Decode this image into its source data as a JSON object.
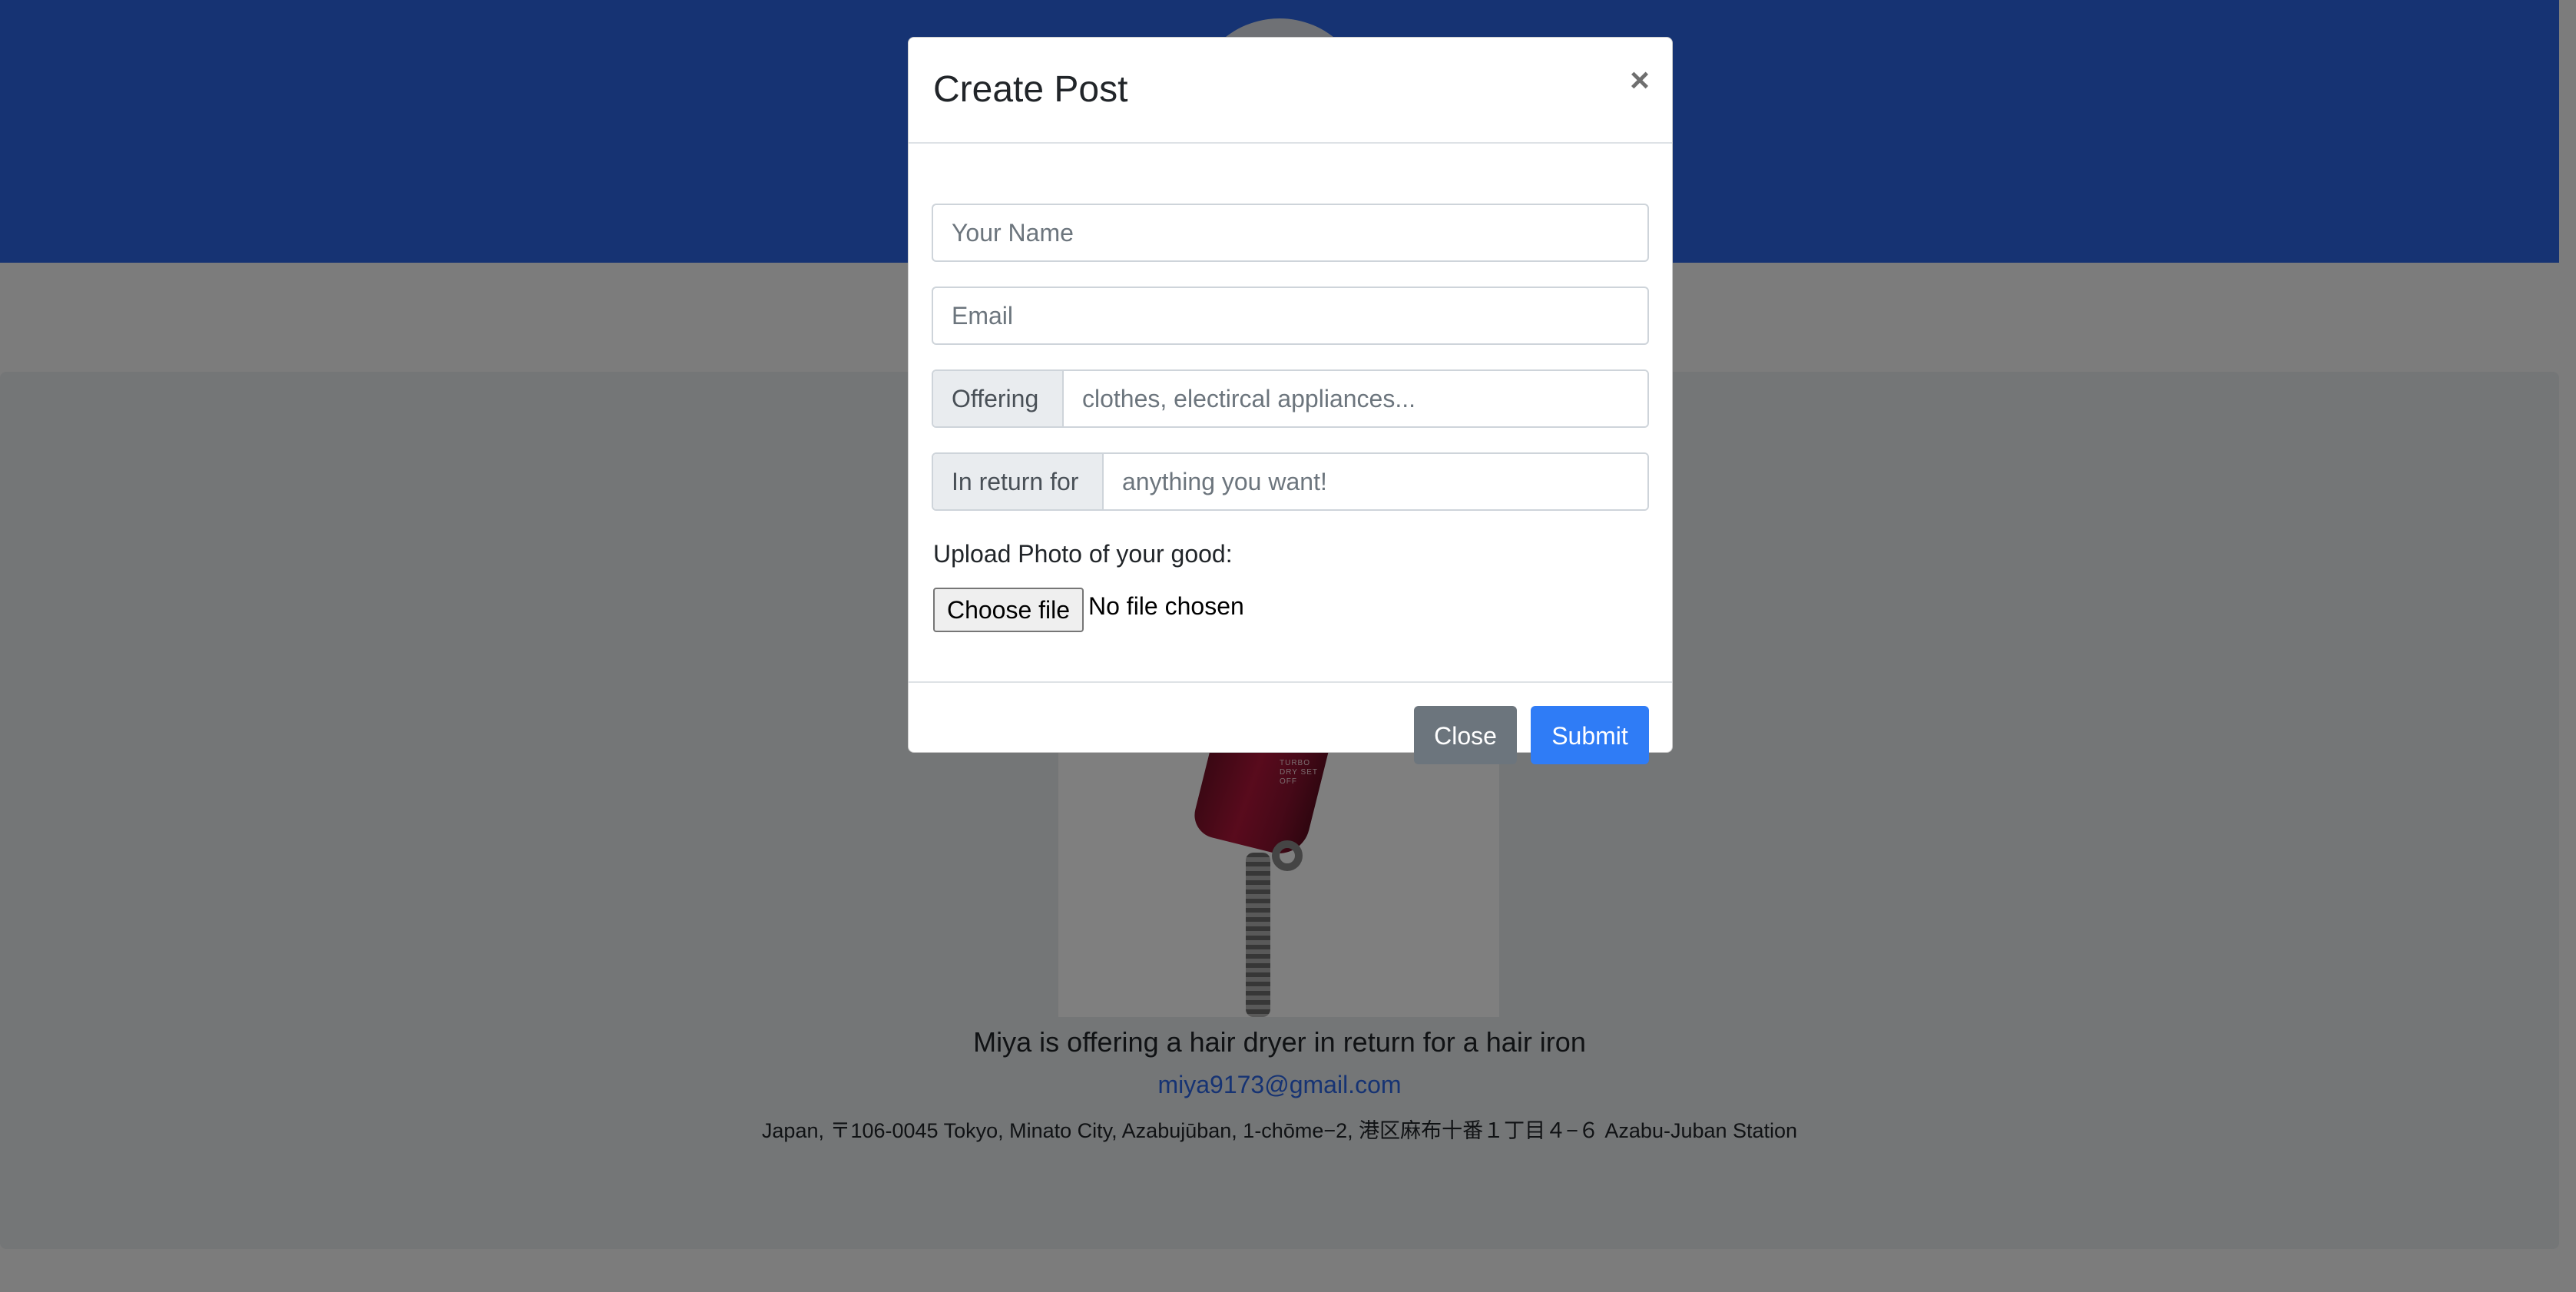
{
  "modal": {
    "title": "Create Post",
    "close_icon": "×",
    "fields": {
      "name_placeholder": "Your Name",
      "email_placeholder": "Email",
      "offering_label": "Offering",
      "offering_placeholder": "clothes, electircal appliances...",
      "return_label": "In return for",
      "return_placeholder": "anything you want!"
    },
    "upload": {
      "label": "Upload Photo of your good:",
      "button_label": "Choose file",
      "status": "No file chosen"
    },
    "footer": {
      "close_label": "Close",
      "submit_label": "Submit"
    }
  },
  "post": {
    "title": "Miya is offering a hair dryer in return for a hair iron",
    "email": "miya9173@gmail.com",
    "address": "Japan, 〒106-0045 Tokyo, Minato City, Azabujūban, 1-chōme−2, 港区麻布十番１丁目４−６ Azabu-Juban Station",
    "photo_labels": "TURBO DRY SET OFF"
  },
  "colors": {
    "hero": "#2c67e6",
    "submit": "#2f7cf6",
    "close": "#6c757d",
    "link": "#2c67e6"
  }
}
